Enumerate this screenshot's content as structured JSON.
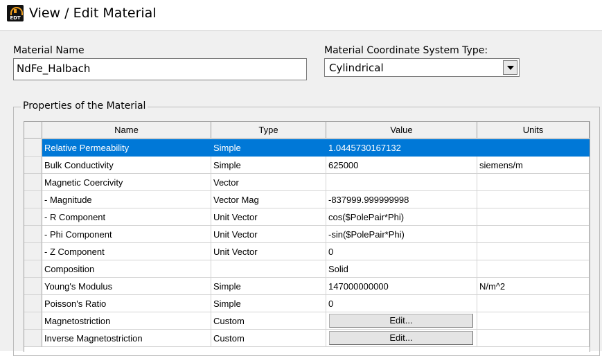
{
  "window": {
    "title": "View / Edit Material",
    "icon": "edt-app-icon",
    "icon_text": "EDT"
  },
  "material_name": {
    "label": "Material Name",
    "value": "NdFe_Halbach"
  },
  "coordinate_system": {
    "label": "Material Coordinate System Type:",
    "selected": "Cylindrical"
  },
  "properties": {
    "group_title": "Properties of the Material",
    "columns": [
      "Name",
      "Type",
      "Value",
      "Units"
    ],
    "rows": [
      {
        "name": "Relative Permeability",
        "type": "Simple",
        "value": "1.0445730167132",
        "units": "",
        "selected": true
      },
      {
        "name": "Bulk Conductivity",
        "type": "Simple",
        "value": "625000",
        "units": "siemens/m"
      },
      {
        "name": "Magnetic Coercivity",
        "type": "Vector",
        "value": "",
        "units": ""
      },
      {
        "name": "- Magnitude",
        "type": "Vector Mag",
        "value": "-837999.999999998",
        "units": ""
      },
      {
        "name": "- R Component",
        "type": "Unit Vector",
        "value": "cos($PolePair*Phi)",
        "units": ""
      },
      {
        "name": "- Phi Component",
        "type": "Unit Vector",
        "value": "-sin($PolePair*Phi)",
        "units": ""
      },
      {
        "name": "- Z Component",
        "type": "Unit Vector",
        "value": "0",
        "units": ""
      },
      {
        "name": "Composition",
        "type": "",
        "value": "Solid",
        "units": ""
      },
      {
        "name": "Young's Modulus",
        "type": "Simple",
        "value": "147000000000",
        "units": "N/m^2"
      },
      {
        "name": "Poisson's Ratio",
        "type": "Simple",
        "value": "0",
        "units": ""
      },
      {
        "name": "Magnetostriction",
        "type": "Custom",
        "value": "",
        "button": "Edit...",
        "units": ""
      },
      {
        "name": "Inverse Magnetostriction",
        "type": "Custom",
        "value": "",
        "button": "Edit...",
        "units": ""
      }
    ]
  }
}
